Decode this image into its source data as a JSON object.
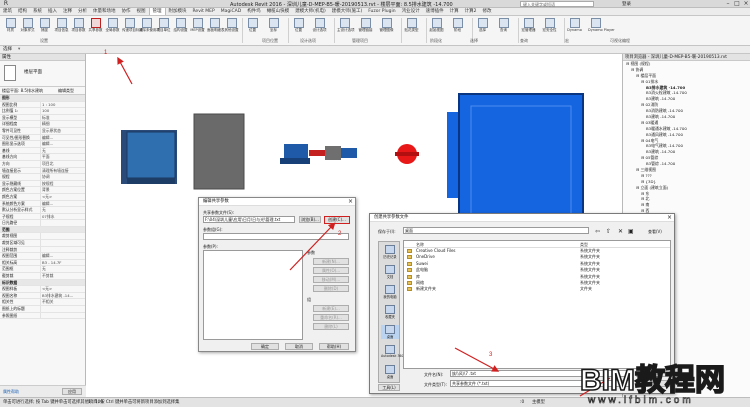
{
  "window": {
    "title": "Autodesk Revit 2016 - 深圳儿童-D-MEP-B5-暖-20190513.rvt - 楼层平面: 8.5排水建筑 -14.700",
    "search_placeholder": "键入关键字或短语",
    "user": "登录"
  },
  "tabs": [
    "建筑",
    "结构",
    "系统",
    "插入",
    "注释",
    "分析",
    "体量和场地",
    "协作",
    "视图",
    "管理",
    "附加模块",
    "Revit MEP",
    "MagiCAD",
    "构件坞",
    "橄榄山快模",
    "建模大师(机电)",
    "建模大师(施工)",
    "Fuzor Plugin",
    "鸿业设计",
    "速博插件",
    "计算",
    "计算2",
    "修改"
  ],
  "active_tab": "管理",
  "ribbon": {
    "buttons": [
      "材质",
      "对象样式",
      "捕捉",
      "项目信息",
      "项目参数",
      "共享参数",
      "全局参数",
      "传递项目标准",
      "清除未使用项",
      "项目单位",
      "结构设置",
      "MEP设置",
      "面板明细表",
      "其他设置",
      "位置",
      "坐标",
      "位置",
      "设计选项",
      "主设计选项",
      "管理链接",
      "管理图像",
      "贴花类型",
      "起始视图",
      "阶段",
      "选择",
      "查询",
      "宏管理器",
      "宏安全性",
      "Dynamo",
      "Dynamo Player"
    ],
    "groups": [
      "设置",
      "项目位置",
      "设计选项",
      "管理项目",
      "阶段化",
      "选择",
      "查询",
      "宏",
      "可视化编程"
    ]
  },
  "selbar": {
    "label": "选择",
    "filter": "修改"
  },
  "properties": {
    "header": "属性",
    "type_name": "楼层平面",
    "filter": "楼层平面: 8.5排水建筑",
    "edit_type": "编辑类型",
    "rows": [
      {
        "k": "图形",
        "v": "",
        "sec": true
      },
      {
        "k": "视图比例",
        "v": "1 : 100"
      },
      {
        "k": "比例值 1:",
        "v": "100"
      },
      {
        "k": "显示模型",
        "v": "标准"
      },
      {
        "k": "详细程度",
        "v": "精细"
      },
      {
        "k": "零件可见性",
        "v": "显示原状态"
      },
      {
        "k": "可见性/图形替换",
        "v": "编辑..."
      },
      {
        "k": "图形显示选项",
        "v": "编辑..."
      },
      {
        "k": "基线",
        "v": "无"
      },
      {
        "k": "基线方向",
        "v": "平面"
      },
      {
        "k": "方向",
        "v": "项目北"
      },
      {
        "k": "墙连接显示",
        "v": "清理所有墙连接"
      },
      {
        "k": "规程",
        "v": "协调"
      },
      {
        "k": "显示隐藏线",
        "v": "按规程"
      },
      {
        "k": "颜色方案位置",
        "v": "背景"
      },
      {
        "k": "颜色方案",
        "v": "<无>"
      },
      {
        "k": "系统颜色方案",
        "v": "编辑..."
      },
      {
        "k": "默认分析显示样式",
        "v": "无"
      },
      {
        "k": "子规程",
        "v": "07排水"
      },
      {
        "k": "日光路径",
        "v": ""
      },
      {
        "k": "范围",
        "v": "",
        "sec": true
      },
      {
        "k": "裁剪视图",
        "v": ""
      },
      {
        "k": "裁剪区域可见",
        "v": ""
      },
      {
        "k": "注释裁剪",
        "v": ""
      },
      {
        "k": "视图范围",
        "v": "编辑..."
      },
      {
        "k": "相关标高",
        "v": "B3 - 14.7F"
      },
      {
        "k": "范围框",
        "v": "无"
      },
      {
        "k": "截剪裁",
        "v": "不剪裁"
      },
      {
        "k": "标识数据",
        "v": "",
        "sec": true
      },
      {
        "k": "视图样板",
        "v": "<无>"
      },
      {
        "k": "视图名称",
        "v": "B3排水建筑 -14..."
      },
      {
        "k": "相关性",
        "v": "不相关"
      },
      {
        "k": "图纸上的标题",
        "v": ""
      },
      {
        "k": "参照图纸",
        "v": ""
      }
    ],
    "help_link": "属性帮助",
    "apply": "应用"
  },
  "browser": {
    "header": "项目浏览器 - 深圳儿童-D-MEP-B5-暖-20190513.rvt",
    "items": [
      {
        "t": "视图 (规程)",
        "d": 0
      },
      {
        "t": "协调",
        "d": 1
      },
      {
        "t": "楼层平面",
        "d": 2
      },
      {
        "t": "01排水",
        "d": 3
      },
      {
        "t": "B3排水建筑 -14.700",
        "d": 4,
        "b": true
      },
      {
        "t": "B3消火栓建筑 -14.700",
        "d": 4
      },
      {
        "t": "B3建筑 -14.700",
        "d": 4
      },
      {
        "t": "02消防",
        "d": 3
      },
      {
        "t": "B3消防建筑 -14.700",
        "d": 4
      },
      {
        "t": "B3建筑 -14.700",
        "d": 4
      },
      {
        "t": "03暖通",
        "d": 3
      },
      {
        "t": "B3暖通水建筑 -14.700",
        "d": 4
      },
      {
        "t": "B3通风建筑 -14.700",
        "d": 4
      },
      {
        "t": "04电气",
        "d": 3
      },
      {
        "t": "B3电气建筑 -14.700",
        "d": 4
      },
      {
        "t": "B3建筑 -14.700",
        "d": 4
      },
      {
        "t": "05管综",
        "d": 3
      },
      {
        "t": "B3管综 -14.700",
        "d": 4
      },
      {
        "t": "三维视图",
        "d": 2
      },
      {
        "t": "???",
        "d": 3
      },
      {
        "t": "{3D}",
        "d": 3
      },
      {
        "t": "立面 (建筑立面)",
        "d": 2
      },
      {
        "t": "东",
        "d": 3
      },
      {
        "t": "北",
        "d": 3
      },
      {
        "t": "南",
        "d": 3
      },
      {
        "t": "西",
        "d": 3
      },
      {
        "t": "剖面 (建筑剖面)",
        "d": 2
      },
      {
        "t": "剖面 1",
        "d": 3
      },
      {
        "t": "图例",
        "d": 1
      },
      {
        "t": "明细表/数量",
        "d": 1
      },
      {
        "t": "图纸 (全部)",
        "d": 1
      },
      {
        "t": "族",
        "d": 1
      },
      {
        "t": "组",
        "d": 1
      },
      {
        "t": "Revit 链接",
        "d": 1
      }
    ]
  },
  "status": {
    "scale": "1 : 100",
    "hint": "单击可进行选择; 按 Tab 键并单击可选择其他项目; 按 Ctrl 键并单击可将新项目添加到选择集",
    "model": "主模型",
    "zero": ":0"
  },
  "dialog1": {
    "title": "编辑共享参数",
    "file_label": "共享参数文件(S):",
    "file_value": "F:\\04\\深圳儿童\\应用\\日月\\日与光\\管理.txt",
    "browse": "浏览(B)...",
    "create": "创建(C)...",
    "group_label": "参数组(G):",
    "params_label": "参数(P):",
    "param_header": "参数",
    "group_header": "组",
    "param_btns": [
      "新建(N)...",
      "属性(O)...",
      "移动(M)...",
      "删除(D)"
    ],
    "group_btns": [
      "新建(E)...",
      "重命名(R)...",
      "删除(L)"
    ],
    "ok": "确定",
    "cancel": "取消",
    "help": "帮助(H)"
  },
  "dialog2": {
    "title": "创建共享参数文件",
    "save_in_label": "保存于(I):",
    "save_in_value": "桌面",
    "views_label": "查看(V)",
    "col_name": "名称",
    "col_type": "类型",
    "files": [
      {
        "n": "Creative Cloud Files",
        "t": "系统文件夹"
      },
      {
        "n": "OneDrive",
        "t": "系统文件夹"
      },
      {
        "n": "Suwei",
        "t": "系统文件夹"
      },
      {
        "n": "此电脑",
        "t": "系统文件夹"
      },
      {
        "n": "库",
        "t": "系统文件夹"
      },
      {
        "n": "网络",
        "t": "系统文件夹"
      },
      {
        "n": "新建文件夹",
        "t": "文件夹"
      }
    ],
    "places": [
      "历史记录",
      "文档",
      "我的电脑",
      "收藏夹",
      "桌面",
      "Autodesk 360",
      "桌面"
    ],
    "filename_label": "文件名(N):",
    "filename_value": "族\\\\风\\\\7 .txt",
    "filetype_label": "文件类型(T):",
    "filetype_value": "共享参数文件 (*.txt)",
    "save": "保存(S)",
    "cancel": "取消(C)",
    "tools": "工具(L)"
  },
  "annotations": [
    "1",
    "2",
    "3"
  ],
  "watermark": {
    "text": "BIM教程网",
    "url": "www.lfbim.com"
  },
  "colors": {
    "annotation": "#d02020",
    "pump_blue": "#1565e0",
    "red_valve": "#e81818"
  }
}
